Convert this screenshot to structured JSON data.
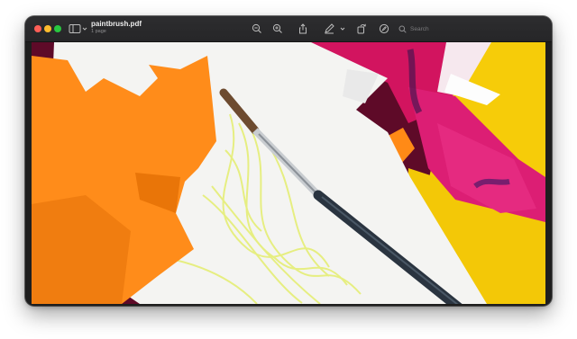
{
  "window": {
    "title": "paintbrush.pdf",
    "subtitle": "1 page"
  },
  "search": {
    "placeholder": "Search"
  },
  "toolbar": {
    "buttons": [
      "sidebar-toggle",
      "zoom-out",
      "zoom-in",
      "share",
      "markup",
      "rotate",
      "annotate"
    ]
  },
  "colors": {
    "titlebar": "#2a2a2c",
    "traffic_close": "#ff5f57",
    "traffic_minimize": "#febc2e",
    "traffic_zoom": "#28c840",
    "paper_orange": "#ff8c1a",
    "paper_pink": "#d81b72",
    "paper_yellow": "#f7cd0a",
    "crayon": "#e6ef6a"
  }
}
